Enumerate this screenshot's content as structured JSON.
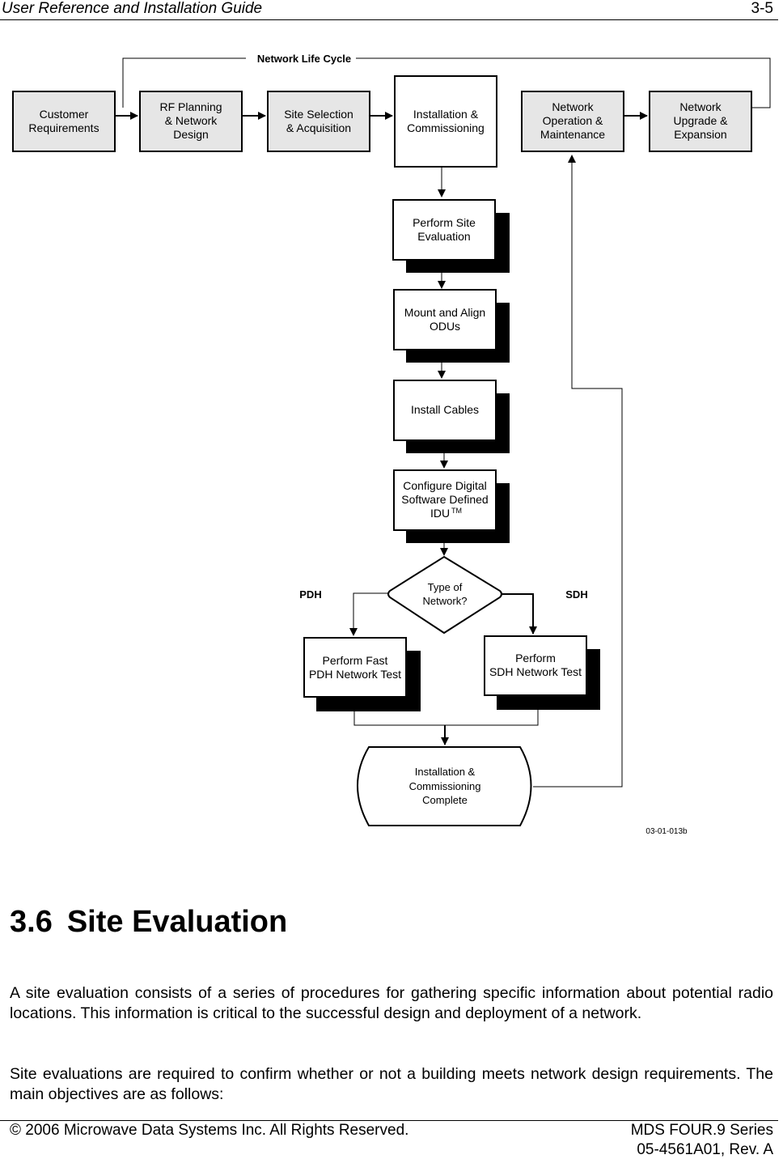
{
  "header": {
    "title": "User Reference and Installation Guide",
    "page_number": "3-5"
  },
  "diagram": {
    "loop_label": "Network Life Cycle",
    "life_cycle_boxes": [
      {
        "id": "customer-requirements",
        "lines": [
          "Customer",
          "Requirements"
        ]
      },
      {
        "id": "rf-planning",
        "lines": [
          "RF Planning",
          "& Network",
          "Design"
        ]
      },
      {
        "id": "site-selection",
        "lines": [
          "Site Selection",
          "& Acquisition"
        ]
      },
      {
        "id": "installation-commissioning",
        "lines": [
          "Installation &",
          "Commissioning"
        ]
      },
      {
        "id": "network-operation",
        "lines": [
          "Network",
          "Operation &",
          "Maintenance"
        ]
      },
      {
        "id": "network-upgrade",
        "lines": [
          "Network",
          "Upgrade &",
          "Expansion"
        ]
      }
    ],
    "steps": [
      {
        "id": "perform-site-evaluation",
        "lines": [
          "Perform Site",
          "Evaluation"
        ]
      },
      {
        "id": "mount-align-odus",
        "lines": [
          "Mount and Align",
          "ODUs"
        ]
      },
      {
        "id": "install-cables",
        "lines": [
          "Install Cables"
        ]
      },
      {
        "id": "configure-idu",
        "lines": [
          "Configure Digital",
          "Software Defined",
          "IDU"
        ],
        "superscript": "TM"
      }
    ],
    "decision": {
      "lines": [
        "Type of",
        "Network?"
      ]
    },
    "branch_left_label": "PDH",
    "branch_right_label": "SDH",
    "branch_left_box": {
      "lines": [
        "Perform Fast",
        "PDH Network Test"
      ]
    },
    "branch_right_box": {
      "lines": [
        "Perform",
        "SDH Network Test"
      ]
    },
    "terminal": {
      "lines": [
        "Installation &",
        "Commissioning",
        "Complete"
      ]
    },
    "figure_id": "03-01-013b"
  },
  "section": {
    "number": "3.6",
    "title": "Site Evaluation"
  },
  "paragraphs": [
    "A site evaluation consists of a series of procedures for gathering specific information about potential radio locations.  This information is critical to the successful design and deployment of a network.",
    "Site evaluations are required to confirm whether or not a building meets network design requirements.  The main objectives are as follows:"
  ],
  "footer": {
    "copyright": "© 2006 Microwave Data Systems Inc.  All Rights Reserved.",
    "product": "MDS FOUR.9 Series",
    "doc_number": "05-4561A01, Rev. A"
  },
  "colors": {
    "box_fill_gray": "#e6e6e6",
    "box_fill_white": "#ffffff",
    "stroke": "#000000"
  }
}
